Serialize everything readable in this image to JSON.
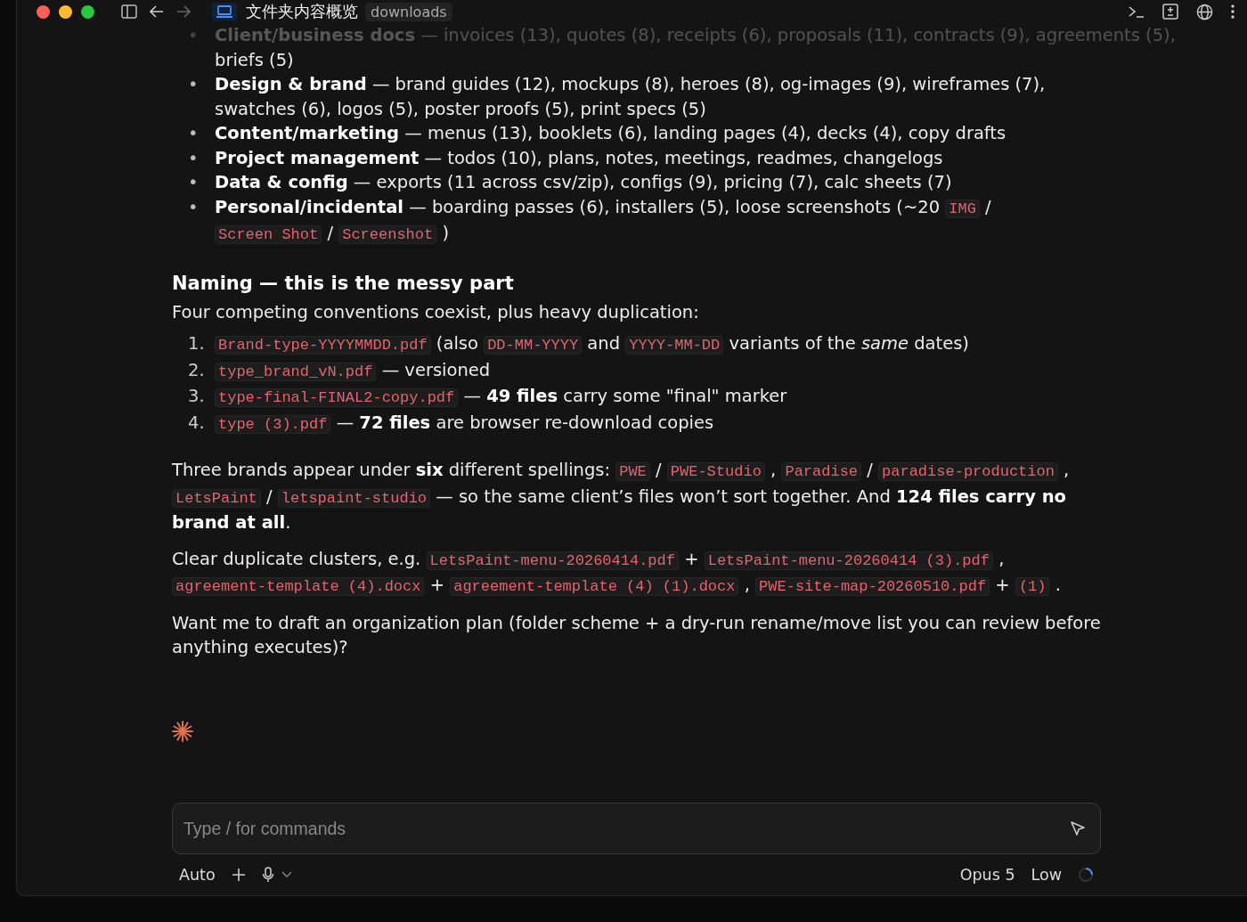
{
  "toolbar": {
    "title": "文件夹内容概览",
    "tag": "downloads"
  },
  "faded_item": {
    "marker": "•",
    "label": "Client/business docs",
    "text": " — invoices (13), quotes (8), receipts (6), proposals (11), contracts (9), agreements (5),"
  },
  "continuation": "briefs (5)",
  "categories": [
    {
      "marker": "•",
      "segments": [
        {
          "kind": "text",
          "text": "**Design & brand** — brand guides (12), mockups (8), heroes (8), og-images (9), wireframes (7), swatches (6), logos (5), poster proofs (5), print specs (5)"
        }
      ]
    },
    {
      "marker": "•",
      "segments": [
        {
          "kind": "text",
          "text": "**Content/marketing** — menus (13), booklets (6), landing pages (4), decks (4), copy drafts"
        }
      ]
    },
    {
      "marker": "•",
      "segments": [
        {
          "kind": "text",
          "text": "**Project management** — todos (10), plans, notes, meetings, readmes, changelogs"
        }
      ]
    },
    {
      "marker": "•",
      "segments": [
        {
          "kind": "text",
          "text": "**Data & config** — exports (11 across csv/zip), configs (9), pricing (7), calc sheets (7)"
        }
      ]
    },
    {
      "marker": "•",
      "segments": [
        {
          "kind": "text",
          "text": "**Personal/incidental** — boarding passes (6), installers (5), loose screenshots (~20"
        },
        {
          "kind": "code",
          "text": "IMG"
        },
        {
          "kind": "text",
          "text": "/"
        },
        {
          "kind": "code",
          "text": "Screen Shot"
        },
        {
          "kind": "text",
          "text": "/"
        },
        {
          "kind": "code",
          "text": "Screenshot"
        },
        {
          "kind": "text",
          "text": ")"
        }
      ]
    }
  ],
  "heading": "Naming — this is the messy part",
  "intro": "Four competing conventions coexist, plus heavy duplication:",
  "conventions": [
    {
      "number": "1.",
      "segments": [
        {
          "kind": "code",
          "text": "Brand-type-YYYYMMDD.pdf"
        },
        {
          "kind": "text",
          "text": "(also"
        },
        {
          "kind": "code",
          "text": "DD-MM-YYYY"
        },
        {
          "kind": "text",
          "text": "and"
        },
        {
          "kind": "code",
          "text": "YYYY-MM-DD"
        },
        {
          "kind": "text",
          "text": "variants of the *same* dates)"
        }
      ]
    },
    {
      "number": "2.",
      "segments": [
        {
          "kind": "code",
          "text": "type_brand_vN.pdf"
        },
        {
          "kind": "text",
          "text": "— versioned"
        }
      ]
    },
    {
      "number": "3.",
      "segments": [
        {
          "kind": "code",
          "text": "type-final-FINAL2-copy.pdf"
        },
        {
          "kind": "text",
          "text": "— **49 files** carry some \"final\" marker"
        }
      ]
    },
    {
      "number": "4.",
      "segments": [
        {
          "kind": "code",
          "text": "type (3).pdf"
        },
        {
          "kind": "text",
          "text": "— **72 files** are browser re-download copies"
        }
      ]
    }
  ],
  "paragraphs": [
    {
      "segments": [
        {
          "kind": "text",
          "text": "Three brands appear under **six** different spellings:"
        },
        {
          "kind": "code",
          "text": "PWE"
        },
        {
          "kind": "text",
          "text": "/"
        },
        {
          "kind": "code",
          "text": "PWE-Studio"
        },
        {
          "kind": "text",
          "text": ","
        },
        {
          "kind": "code",
          "text": "Paradise"
        },
        {
          "kind": "text",
          "text": "/"
        },
        {
          "kind": "code",
          "text": "paradise-production"
        },
        {
          "kind": "text",
          "text": ","
        },
        {
          "kind": "code",
          "text": "LetsPaint"
        },
        {
          "kind": "text",
          "text": "/"
        },
        {
          "kind": "code",
          "text": "letspaint-studio"
        },
        {
          "kind": "text",
          "text": "— so the same client’s files won’t sort together. And **124 files carry no brand at all**."
        }
      ]
    },
    {
      "segments": [
        {
          "kind": "text",
          "text": "Clear duplicate clusters, e.g."
        },
        {
          "kind": "code",
          "text": "LetsPaint-menu-20260414.pdf"
        },
        {
          "kind": "text",
          "text": "+"
        },
        {
          "kind": "code",
          "text": "LetsPaint-menu-20260414 (3).pdf"
        },
        {
          "kind": "text",
          "text": ","
        },
        {
          "kind": "code",
          "text": "agreement-template (4).docx"
        },
        {
          "kind": "text",
          "text": "+"
        },
        {
          "kind": "code",
          "text": "agreement-template (4) (1).docx"
        },
        {
          "kind": "text",
          "text": ","
        },
        {
          "kind": "code",
          "text": "PWE-site-map-20260510.pdf"
        },
        {
          "kind": "text",
          "text": "+"
        },
        {
          "kind": "code",
          "text": "(1)"
        },
        {
          "kind": "text",
          "text": "."
        }
      ]
    },
    {
      "segments": [
        {
          "kind": "text",
          "text": "Want me to draft an organization plan (folder scheme + a dry-run rename/move list you can review before anything executes)?"
        }
      ]
    }
  ],
  "composer": {
    "placeholder": "Type / for commands"
  },
  "footer": {
    "mode": "Auto",
    "model": "Opus 5",
    "effort": "Low"
  }
}
